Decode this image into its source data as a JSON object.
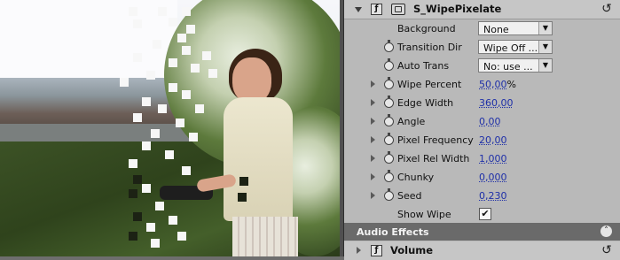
{
  "preview": {
    "description_icon": "video-frame"
  },
  "effect": {
    "name": "S_WipePixelate",
    "fx_label": "ƒ",
    "reset_glyph": "↺",
    "params": [
      {
        "label": "Background",
        "kind": "dropdown",
        "value": "None",
        "stopwatch": false,
        "expand": false
      },
      {
        "label": "Transition Dir",
        "kind": "dropdown",
        "value": "Wipe Off ...",
        "stopwatch": true,
        "expand": false
      },
      {
        "label": "Auto Trans",
        "kind": "dropdown",
        "value": "No: use ...",
        "stopwatch": true,
        "expand": false
      },
      {
        "label": "Wipe Percent",
        "kind": "number",
        "value": "50,00",
        "unit": "%",
        "stopwatch": true,
        "expand": true
      },
      {
        "label": "Edge Width",
        "kind": "number",
        "value": "360,00",
        "unit": "",
        "stopwatch": true,
        "expand": true
      },
      {
        "label": "Angle",
        "kind": "number",
        "value": "0,00",
        "unit": "",
        "stopwatch": true,
        "expand": true
      },
      {
        "label": "Pixel Frequency",
        "kind": "number",
        "value": "20,00",
        "unit": "",
        "stopwatch": true,
        "expand": true
      },
      {
        "label": "Pixel Rel Width",
        "kind": "number",
        "value": "1,000",
        "unit": "",
        "stopwatch": true,
        "expand": true
      },
      {
        "label": "Chunky",
        "kind": "number",
        "value": "0,000",
        "unit": "",
        "stopwatch": true,
        "expand": true
      },
      {
        "label": "Seed",
        "kind": "number",
        "value": "0,230",
        "unit": "",
        "stopwatch": true,
        "expand": true
      },
      {
        "label": "Show Wipe",
        "kind": "checkbox",
        "value": "✔",
        "stopwatch": false,
        "expand": false
      }
    ]
  },
  "audio_section": {
    "title": "Audio Effects",
    "collapse_glyph": "˄"
  },
  "volume": {
    "name": "Volume",
    "fx_label": "ƒ",
    "reset_glyph": "↺"
  },
  "dropdown_arrow": "▼"
}
